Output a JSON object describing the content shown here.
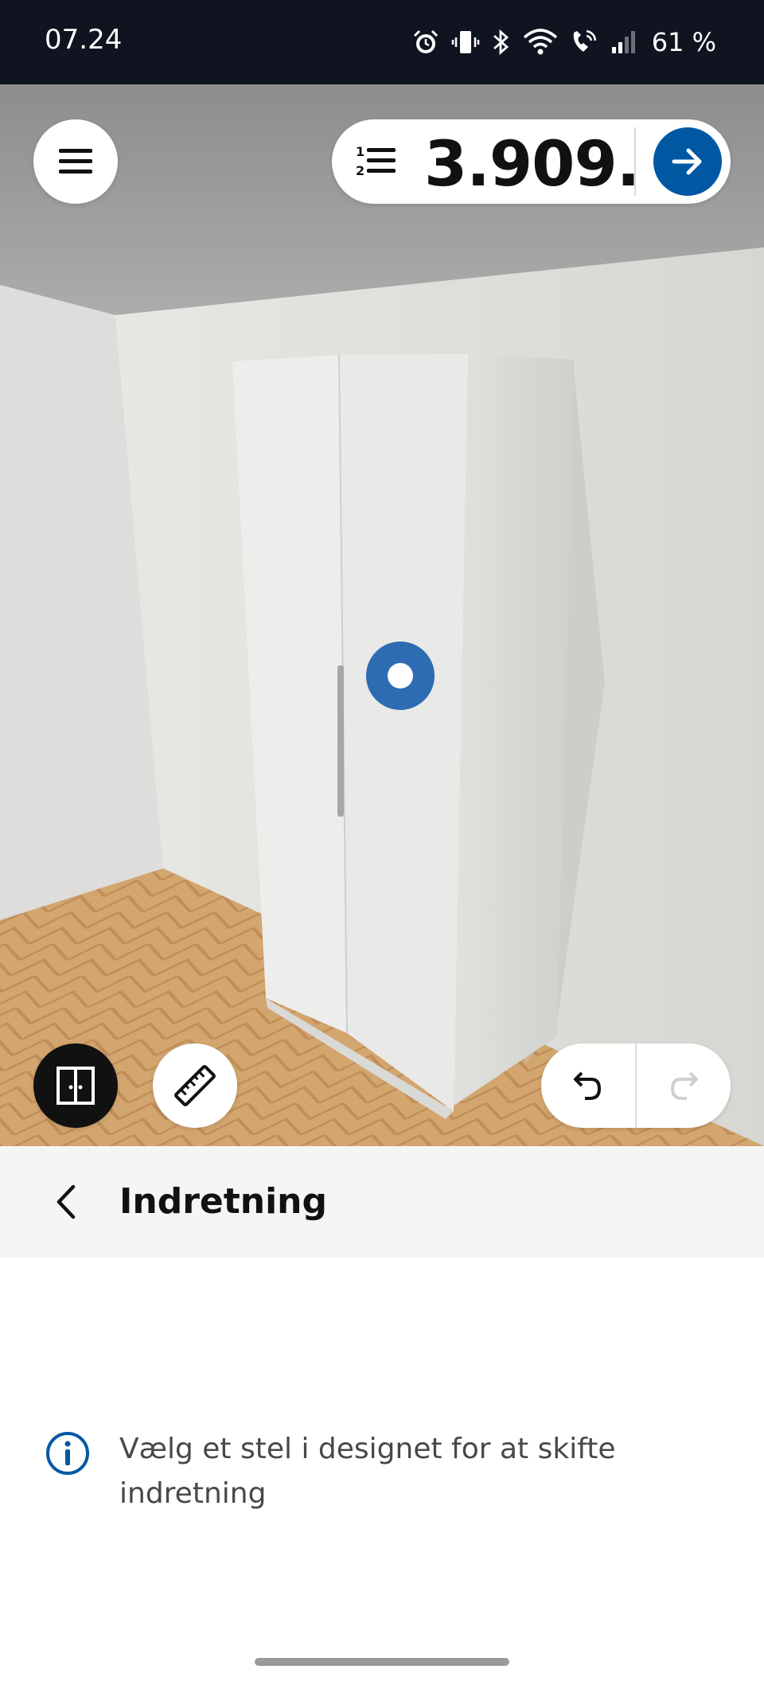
{
  "status_bar": {
    "time": "07.24",
    "battery": "61 %",
    "icons": [
      "alarm-icon",
      "vibrate-icon",
      "bluetooth-icon",
      "wifi-icon",
      "wifi-call-icon",
      "signal-icon"
    ]
  },
  "toolbar": {
    "menu_icon": "hamburger-menu-icon",
    "price": "3.909.",
    "price_suffix": "-",
    "list_icon": "numbered-list-icon",
    "go_icon": "arrow-right-icon"
  },
  "scene": {
    "hotspot_icon": "hotspot-dot-icon",
    "tools": [
      "door-frame-icon",
      "ruler-icon"
    ],
    "undo_icon": "undo-icon",
    "redo_icon": "redo-icon",
    "redo_enabled": false
  },
  "section": {
    "title": "Indretning",
    "back_icon": "chevron-left-icon"
  },
  "info": {
    "icon": "info-icon",
    "text": "Vælg et stel i designet for at skifte indretning"
  },
  "colors": {
    "accent": "#0058a3",
    "hotspot": "#2d6cb3",
    "status_bar": "#0f1420"
  }
}
